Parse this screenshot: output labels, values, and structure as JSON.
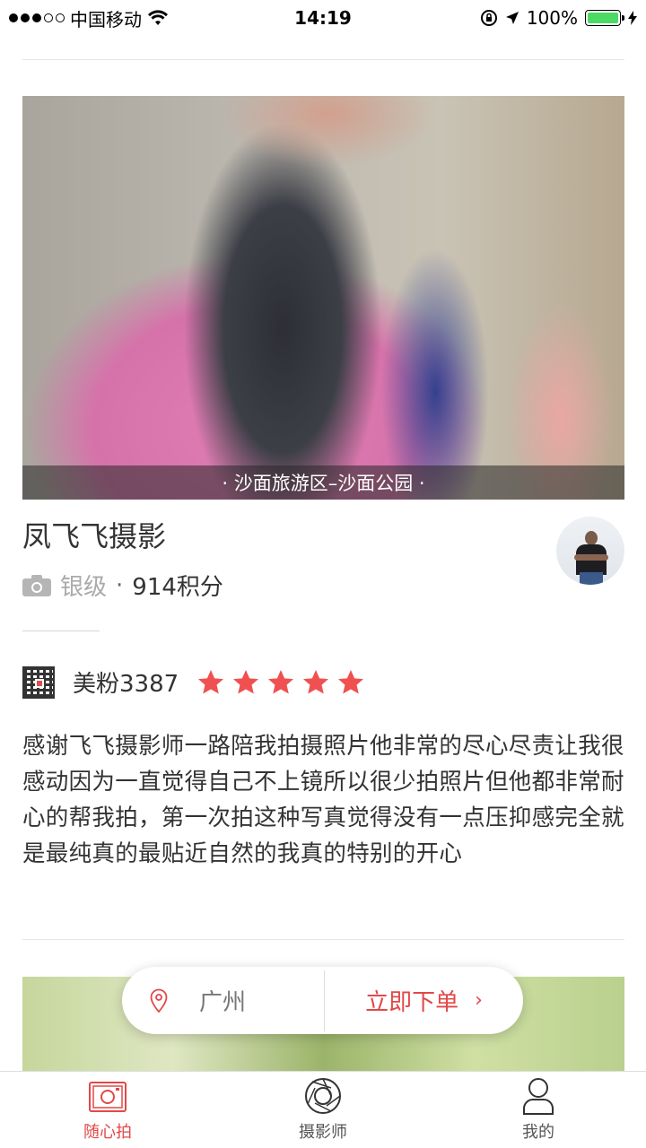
{
  "status_bar": {
    "carrier": "中国移动",
    "time": "14:19",
    "battery": "100%"
  },
  "hero": {
    "location_caption": "· 沙面旅游区–沙面公园 ·"
  },
  "photographer": {
    "name": "凤飞飞摄影",
    "level": "银级",
    "separator": "·",
    "points": "914积分"
  },
  "review": {
    "reviewer_name": "美粉3387",
    "rating": 5,
    "text": "感谢飞飞摄影师一路陪我拍摄照片他非常的尽心尽责让我很感动因为一直觉得自己不上镜所以很少拍照片但他都非常耐心的帮我拍，第一次拍这种写真觉得没有一点压抑感完全就是最纯真的最贴近自然的我真的特别的开心"
  },
  "order_bar": {
    "city": "广州",
    "order_label": "立即下单",
    "chevron": "›"
  },
  "tab_bar": {
    "tabs": [
      {
        "label": "随心拍",
        "icon": "camera-icon",
        "active": true
      },
      {
        "label": "摄影师",
        "icon": "aperture-icon",
        "active": false
      },
      {
        "label": "我的",
        "icon": "person-icon",
        "active": false
      }
    ]
  },
  "colors": {
    "accent": "#e24848",
    "star": "#f05050"
  }
}
